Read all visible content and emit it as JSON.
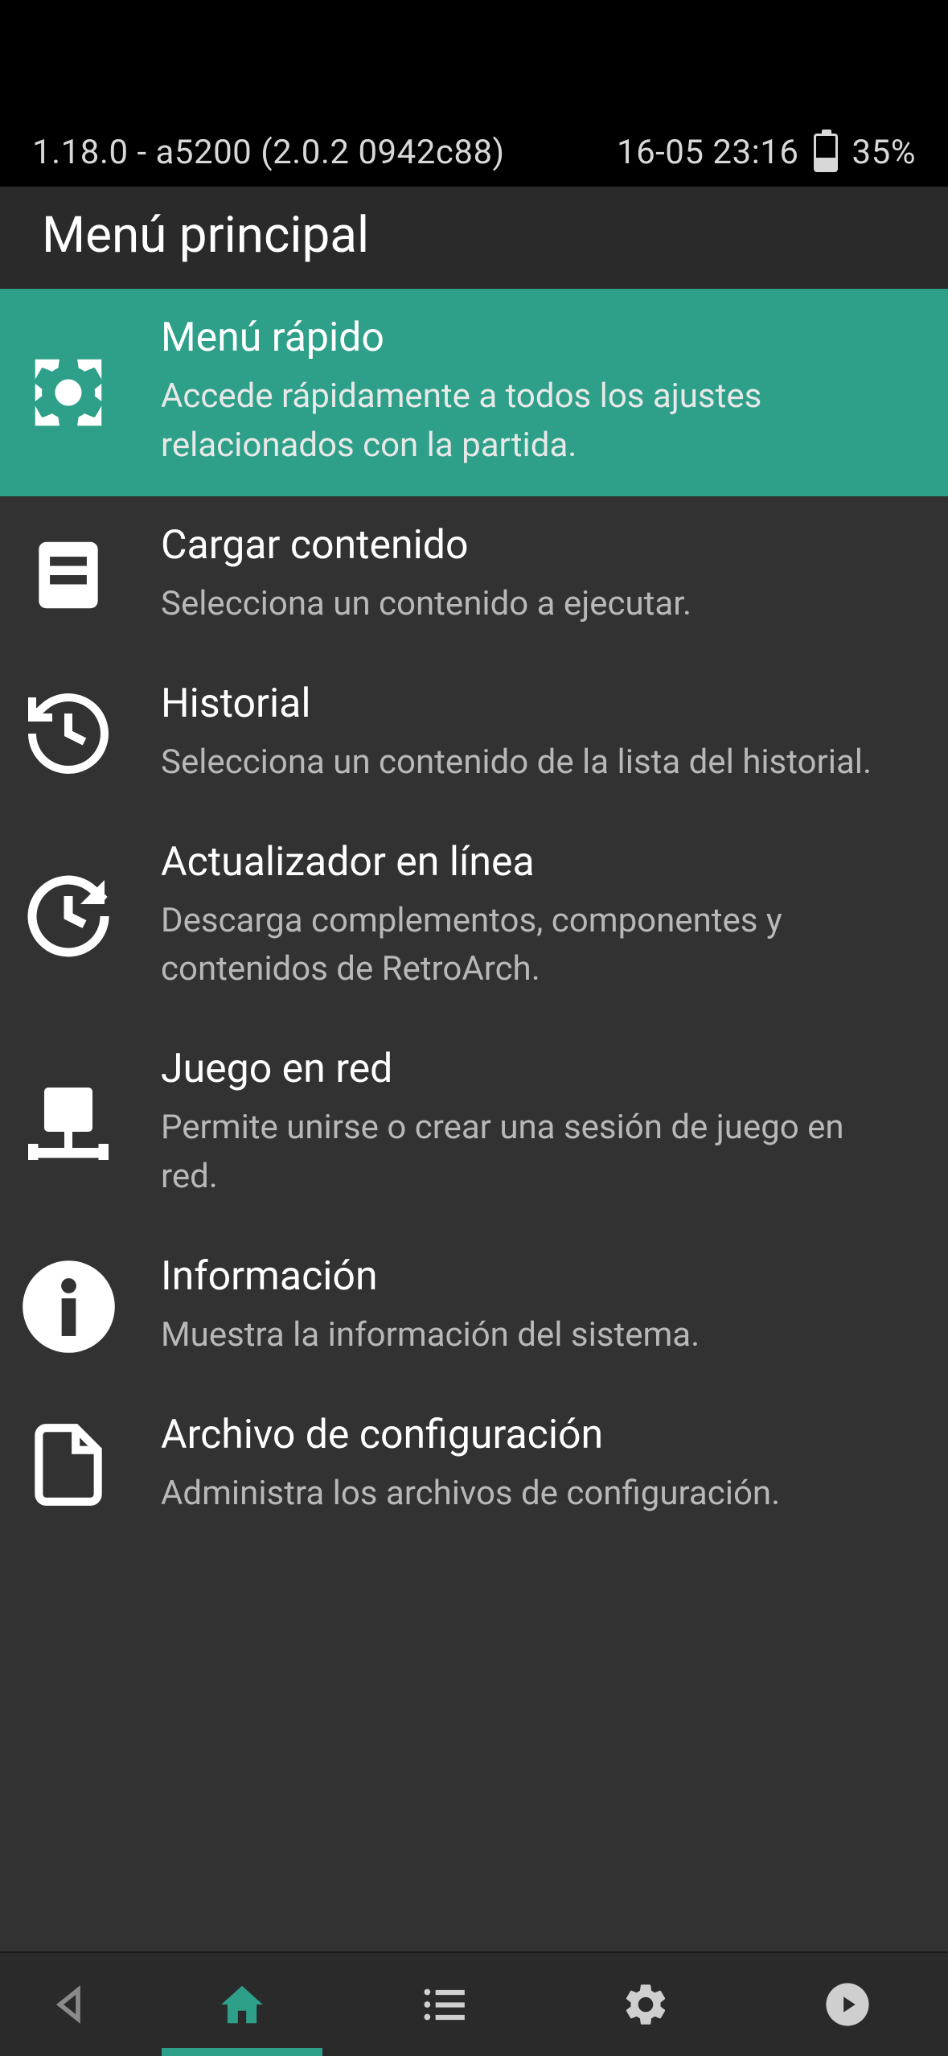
{
  "status": {
    "version": "1.18.0 - a5200 (2.0.2  0942c88)",
    "datetime": "16-05 23:16",
    "battery_pct": "35%"
  },
  "header": {
    "title": "Menú principal"
  },
  "menu": [
    {
      "title": "Menú rápido",
      "subtitle": "Accede rápidamente a todos los ajustes relacionados con la partida."
    },
    {
      "title": "Cargar contenido",
      "subtitle": "Selecciona un contenido a ejecutar."
    },
    {
      "title": "Historial",
      "subtitle": "Selecciona un contenido de la lista del historial."
    },
    {
      "title": "Actualizador en línea",
      "subtitle": "Descarga complementos, componentes y contenidos de RetroArch."
    },
    {
      "title": "Juego en red",
      "subtitle": "Permite unirse o crear una sesión de juego en red."
    },
    {
      "title": "Información",
      "subtitle": "Muestra la información del sistema."
    },
    {
      "title": "Archivo de configuración",
      "subtitle": "Administra los archivos de configuración."
    }
  ],
  "colors": {
    "accent": "#2ea089",
    "bg": "#333232",
    "header_bg": "#2a2a2a"
  }
}
